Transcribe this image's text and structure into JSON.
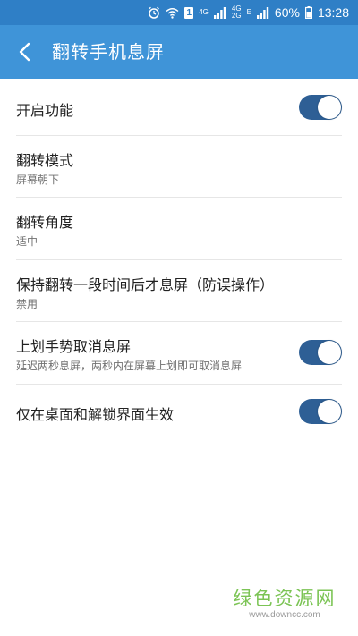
{
  "status_bar": {
    "network_4g": "4G",
    "network_4g_dual": "4G",
    "network_2g": "2G",
    "network_e": "E",
    "sim_slot": "1",
    "battery_percent": "60%",
    "time": "13:28",
    "icons": [
      "alarm-icon",
      "wifi-icon",
      "sim-icon",
      "signal-icon",
      "battery-icon"
    ]
  },
  "header": {
    "title": "翻转手机息屏",
    "back_icon": "chevron-left-icon"
  },
  "settings": {
    "items": [
      {
        "title": "开启功能",
        "subtitle": "",
        "toggle_on": true
      },
      {
        "title": "翻转模式",
        "subtitle": "屏幕朝下"
      },
      {
        "title": "翻转角度",
        "subtitle": "适中"
      },
      {
        "title": "保持翻转一段时间后才息屏（防误操作）",
        "subtitle": "禁用"
      },
      {
        "title": "上划手势取消息屏",
        "subtitle": "延迟两秒息屏，两秒内在屏幕上划即可取消息屏",
        "toggle_on": true
      },
      {
        "title": "仅在桌面和解锁界面生效",
        "subtitle": "",
        "toggle_on": true
      }
    ]
  },
  "watermark": {
    "name": "绿色资源网",
    "url": "www.downcc.com"
  },
  "colors": {
    "status_bar": "#2f7fc6",
    "app_bar": "#3f94d8",
    "toggle_on": "#2e5f95",
    "watermark_green": "#7cc455"
  }
}
